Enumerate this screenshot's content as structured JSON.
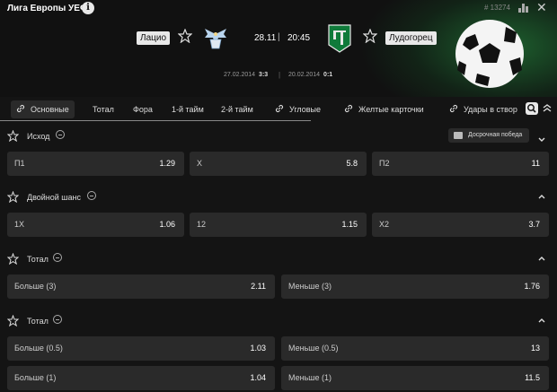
{
  "header": {
    "league": "Лига Европы УЕФА",
    "info_icon": "i",
    "match_id": "# 13274",
    "close_icon": "✕",
    "home_team": "Лацио",
    "away_team": "Лудогорец",
    "date": "28.11",
    "separator": "|",
    "time": "20:45",
    "h2h": [
      {
        "date": "27.02.2014",
        "score": "3:3"
      },
      {
        "date": "20.02.2014",
        "score": "0:1"
      }
    ],
    "h2h_sep": "|"
  },
  "tabs": [
    {
      "label": "Основные",
      "icon": "link-icon",
      "active": true
    },
    {
      "label": "Тотал",
      "icon": null,
      "active": false
    },
    {
      "label": "Фора",
      "icon": null,
      "active": false
    },
    {
      "label": "1-й тайм",
      "icon": null,
      "active": false
    },
    {
      "label": "2-й тайм",
      "icon": null,
      "active": false
    },
    {
      "label": "Угловые",
      "icon": "link-icon",
      "active": false
    },
    {
      "label": "Желтые карточки",
      "icon": "link-icon",
      "active": false
    },
    {
      "label": "Удары в створ",
      "icon": "link-icon",
      "active": false
    }
  ],
  "early_win": "Досрочная победа",
  "markets": [
    {
      "title": "Исход",
      "odds": [
        {
          "label": "П1",
          "value": "1.29"
        },
        {
          "label": "Х",
          "value": "5.8"
        },
        {
          "label": "П2",
          "value": "11"
        }
      ]
    },
    {
      "title": "Двойной шанс",
      "odds": [
        {
          "label": "1Х",
          "value": "1.06"
        },
        {
          "label": "12",
          "value": "1.15"
        },
        {
          "label": "Х2",
          "value": "3.7"
        }
      ]
    },
    {
      "title": "Тотал",
      "odds": [
        {
          "label": "Больше (3)",
          "value": "2.11"
        },
        {
          "label": "Меньше (3)",
          "value": "1.76"
        }
      ]
    },
    {
      "title": "Тотал",
      "odds": [
        {
          "label": "Больше (0.5)",
          "value": "1.03"
        },
        {
          "label": "Меньше (0.5)",
          "value": "13"
        },
        {
          "label": "Больше (1)",
          "value": "1.04"
        },
        {
          "label": "Меньше (1)",
          "value": "11.5"
        }
      ]
    }
  ],
  "colors": {
    "background": "#141414",
    "tile": "#2a2a2a",
    "accent_green": "#2e9e4f"
  }
}
